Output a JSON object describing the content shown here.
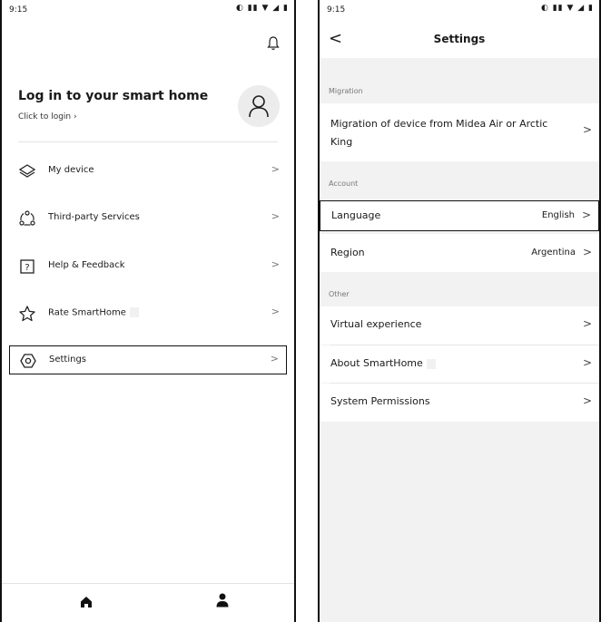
{
  "left": {
    "status_time": "9:15",
    "status_icons": "◐ ▮▮ ▼ ◢ ▮",
    "login": {
      "title": "Log in to your smart home",
      "subtitle": "Click to login ›"
    },
    "menu": [
      {
        "label": "My device",
        "icon": "layers-icon"
      },
      {
        "label": "Third-party Services",
        "icon": "connection-icon"
      },
      {
        "label": "Help & Feedback",
        "icon": "help-icon"
      },
      {
        "label": "Rate SmartHome",
        "icon": "star-icon"
      },
      {
        "label": "Settings",
        "icon": "settings-icon",
        "selected": true
      }
    ],
    "chevron": ">",
    "bottom_nav": [
      "home-icon",
      "profile-icon"
    ]
  },
  "right": {
    "status_time": "9:15",
    "status_icons": "◐ ▮▮ ▼ ◢ ▮",
    "header": {
      "back": "<",
      "title": "Settings"
    },
    "sections": {
      "migration": "Migration",
      "account": "Account",
      "other": "Other"
    },
    "rows": {
      "migration_label": "Migration of device from Midea Air or Arctic King",
      "language_label": "Language",
      "language_value": "English",
      "region_label": "Region",
      "region_value": "Argentina",
      "virtual_label": "Virtual experience",
      "about_label": "About SmartHome",
      "permissions_label": "System Permissions"
    },
    "chevron": ">"
  }
}
